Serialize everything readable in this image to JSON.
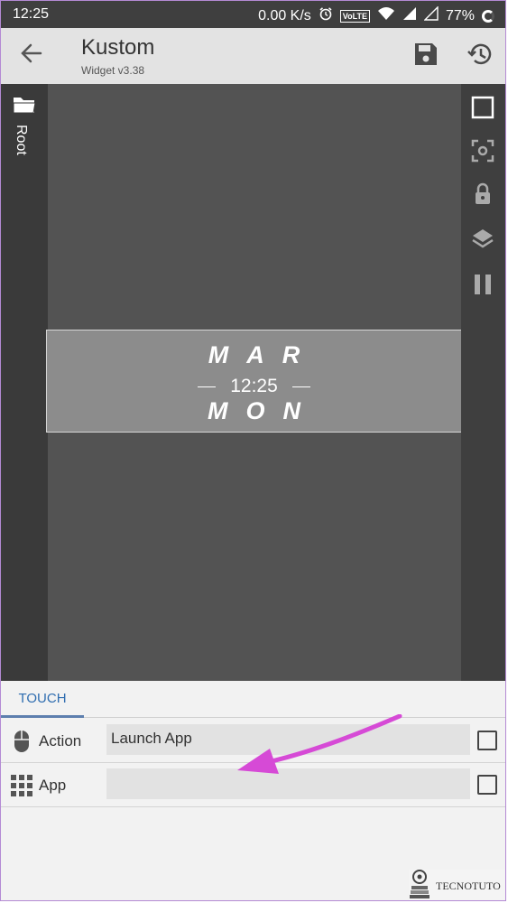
{
  "status_bar": {
    "time": "12:25",
    "network_speed": "0.00 K/s",
    "volte": "VoLTE",
    "battery": "77%"
  },
  "app_bar": {
    "title": "Kustom",
    "subtitle": "Widget v3.38"
  },
  "left_rail": {
    "root_label": "Root"
  },
  "widget": {
    "month": "MAR",
    "time": "12:25",
    "day": "MON"
  },
  "tabs": [
    {
      "label": "TOUCH",
      "selected": true
    }
  ],
  "touch_rows": [
    {
      "label": "Action",
      "value": "Launch App",
      "icon": "mouse-icon"
    },
    {
      "label": "App",
      "value": "",
      "icon": "grid-icon"
    }
  ],
  "watermark": {
    "text": "TECNOTUTO"
  },
  "colors": {
    "accent": "#2f6db0",
    "annotation_arrow": "#d64ad6",
    "canvas": "#535353",
    "widget_bg": "#8c8c8c"
  }
}
